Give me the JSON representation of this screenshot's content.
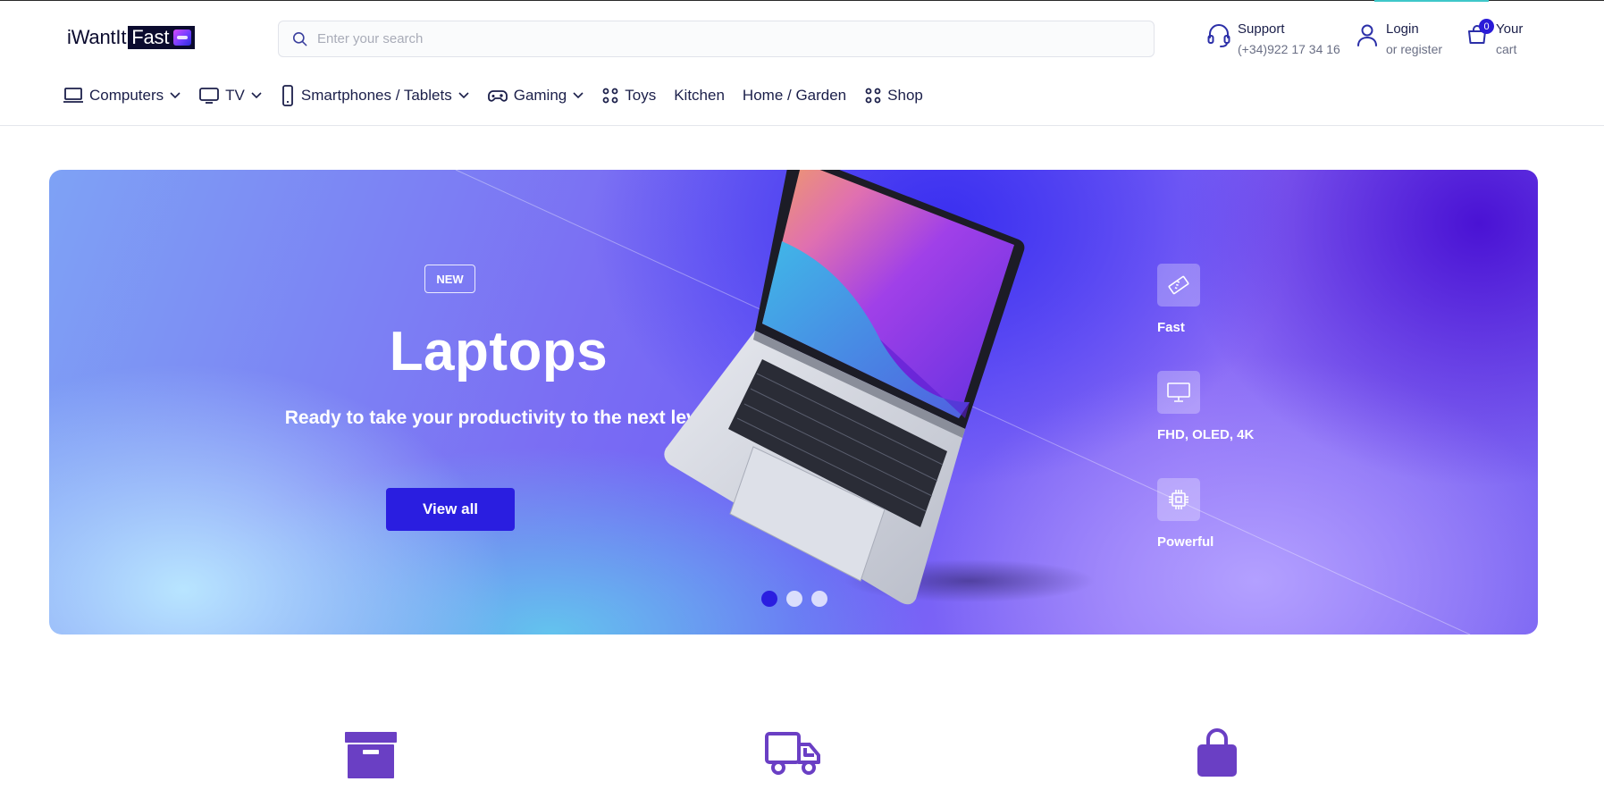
{
  "header": {
    "logo": {
      "text_plain": "iWantIt",
      "text_boxed": "Fast"
    },
    "search": {
      "placeholder": "Enter your search"
    },
    "support": {
      "title": "Support",
      "phone": "(+34)922 17 34 16"
    },
    "login": {
      "title": "Login",
      "sub": "or register"
    },
    "cart": {
      "title": "Your",
      "sub": "cart",
      "count": "0"
    }
  },
  "nav": {
    "items": [
      {
        "label": "Computers",
        "icon": "laptop-icon",
        "dropdown": true
      },
      {
        "label": "TV",
        "icon": "tv-icon",
        "dropdown": true
      },
      {
        "label": "Smartphones / Tablets",
        "icon": "smartphone-icon",
        "dropdown": true
      },
      {
        "label": "Gaming",
        "icon": "gamepad-icon",
        "dropdown": true
      },
      {
        "label": "Toys",
        "icon": "grid-dots-icon",
        "dropdown": false
      },
      {
        "label": "Kitchen",
        "icon": "",
        "dropdown": false
      },
      {
        "label": "Home / Garden",
        "icon": "",
        "dropdown": false
      },
      {
        "label": "Shop",
        "icon": "grid-dots-icon",
        "dropdown": false
      }
    ]
  },
  "hero": {
    "badge": "NEW",
    "title": "Laptops",
    "subtitle": "Ready to take your productivity to the next level",
    "button": "View all",
    "features": [
      {
        "label": "Fast",
        "icon": "ram-icon"
      },
      {
        "label": "FHD, OLED, 4K",
        "icon": "monitor-icon"
      },
      {
        "label": "Powerful",
        "icon": "cpu-icon"
      }
    ],
    "slides": {
      "count": 3,
      "active": 1
    }
  },
  "bottom_icons": [
    "archive-box-icon",
    "delivery-truck-icon",
    "shopping-bag-icon"
  ],
  "colors": {
    "accent": "#2a1ee0",
    "navy": "#1b1f4a",
    "bottom_icon": "#6a3fc4"
  }
}
